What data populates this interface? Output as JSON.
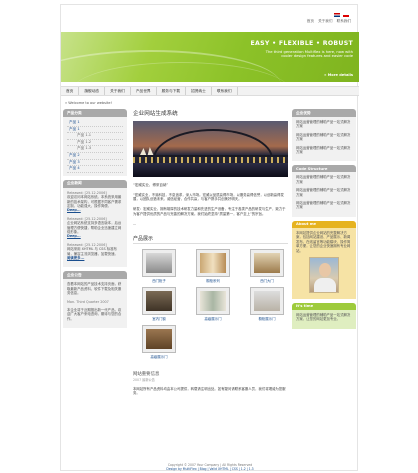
{
  "toplinks": [
    "首页",
    "关于我们",
    "联系我们"
  ],
  "banner": {
    "title": "EASY • FLEXIBLE • ROBUST",
    "tagline": "The third generation Multiflex is here, now with cooler design features and easier code",
    "more": "» More details"
  },
  "nav": [
    "首页",
    "旗舰动态",
    "关于我们",
    "产品世界",
    "服务与下载",
    "招贤纳士",
    "联系我们"
  ],
  "breadcrumb": "» Welcome to our website!",
  "left": {
    "menu_title": "产品分类",
    "menu": [
      {
        "label": "产品 1",
        "sub": false
      },
      {
        "label": "产品 1",
        "sub": false
      },
      {
        "label": "产品 1.1",
        "sub": true
      },
      {
        "label": "产品 1.2",
        "sub": true
      },
      {
        "label": "产品 1.3",
        "sub": true
      },
      {
        "label": "产品 2",
        "sub": false
      },
      {
        "label": "产品 3",
        "sub": false
      },
      {
        "label": "产品 4",
        "sub": false
      }
    ],
    "news_title": "企业新闻",
    "news": [
      {
        "date": "Released: [25.12.2006]",
        "text": "欢迎访问本网站系统。本系统采用最新的技术架构，可根据不同客户需求定制，功能强大、操作简便。",
        "link": "Deep..."
      },
      {
        "date": "Released: [25.12.2006]",
        "text": "企业网站系统支持多语言版本，后台管理方便快捷，帮助企业迅速建立网络形象。",
        "link": "Deep..."
      },
      {
        "date": "Released: [25.12.2006]",
        "text": "网站采用 XHTML 与 CSS 标准布局，兼容主流浏览器，加载快速。",
        "link": "阅读更多..."
      }
    ],
    "notice_title": "企业公告",
    "notice": [
      "查看本网站的产品技术支持页面，获取最新产品资料、软件下载及相关服务信息。",
      "Mon. Third Quarter 2007",
      "本企业将于近期推出新一代产品，欢迎广大客户来电咨询，期待与您的合作。"
    ]
  },
  "main": {
    "title": "企业网站生成系统",
    "quote": "“宏威实业，博采百纳”",
    "para1": "“宏威实业，不渝科技，不息追求，深入市场。宏威以品质赢得市场，以服务赢得信誉，以创新赢得发展，以团队创造未来。诚信经营，合作共赢，与客户携手共创美好明天。”",
    "para2": "研发：宏威实业，拥有雄厚的技术研发力量和先进的生产设备，专注于各类产品的研发与生产，致力于为客户提供优质的产品与完善的解决方案。我们始终坚持“质量第一，客户至上”的宗旨。",
    "para3": "...",
    "products_title": "产品展示",
    "products": [
      "西门柜子",
      "橱柜系列",
      "西门大门",
      "室内门窗",
      "高级展示门",
      "橱柜展示门",
      "高级展示门"
    ],
    "sub_title": "网站重要信息",
    "sub_en": "2007 最新公告",
    "sub_text": "本网站所有产品资料均由本公司提供，转载请注明出处。如有疑问请联系客服人员，我们将竭诚为您服务。"
  },
  "right": {
    "box1_title": "企业优势",
    "box1": [
      "网站运营管理的辅助产品一站式解决方案",
      "网站运营管理的辅助产品一站式解决方案",
      "网站运营管理的辅助产品一站式解决方案"
    ],
    "box2_title": "Code Structure",
    "box2": [
      "网站运营管理的辅助产品一站式解决方案",
      "网站运营管理的辅助产品一站式解决方案",
      "网站运营管理的辅助产品一站式解决方案"
    ],
    "about_title": "About me",
    "about_text": "本网站提供企业网站的完整解决方案，包括网站建设、产品展示、新闻发布、在线留言等功能模块，操作简单方便，让您的企业快速拥有专业网站。",
    "tips_title": "It's time",
    "tips_text": "网站运营管理的辅助产品一站式解决方案，让您的网站更加专业。"
  },
  "footer": {
    "line1": "Copyright © 2007 Your Company | All Rights Reserved",
    "line2": "Design by MultiFlex | Blog | Valid XHTML | CSS | 1.2 | 1.3"
  }
}
